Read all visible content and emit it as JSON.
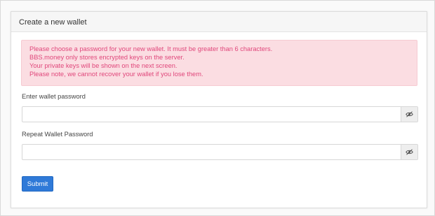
{
  "panel": {
    "title": "Create a new wallet"
  },
  "alert": {
    "color": "#e0477b",
    "background": "#fbdde2",
    "lines": [
      "Please choose a password for your new wallet. It must be greater than 6 characters.",
      "BBS.money only stores encrypted keys on the server.",
      "Your private keys will be shown on the next screen.",
      "Please note, we cannot recover your wallet if you lose them."
    ]
  },
  "form": {
    "password_label": "Enter wallet password",
    "password_value": "",
    "password_toggle_icon": "eye-slash-icon",
    "repeat_label": "Repeat Wallet Password",
    "repeat_value": "",
    "repeat_toggle_icon": "eye-slash-icon",
    "submit_label": "Submit",
    "submit_color": "#2f7ad8"
  }
}
